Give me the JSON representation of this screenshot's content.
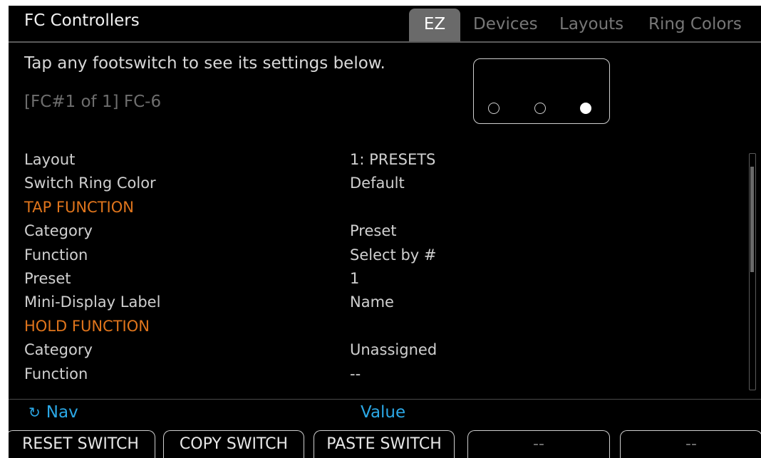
{
  "app": {
    "title": "FC Controllers"
  },
  "tabs": [
    {
      "label": "EZ",
      "active": true
    },
    {
      "label": "Devices",
      "active": false
    },
    {
      "label": "Layouts",
      "active": false
    },
    {
      "label": "Ring Colors",
      "active": false
    }
  ],
  "instruction": "Tap any footswitch to see its settings below.",
  "controller": {
    "name": "[FC#1 of 1] FC-6",
    "footswitches": [
      {
        "selected": false
      },
      {
        "selected": false
      },
      {
        "selected": true
      }
    ]
  },
  "settings": [
    {
      "label": "Layout",
      "value": "1: PRESETS"
    },
    {
      "label": "Switch Ring Color",
      "value": "Default"
    },
    {
      "label": "TAP FUNCTION",
      "value": "",
      "section": true
    },
    {
      "label": "Category",
      "value": "Preset"
    },
    {
      "label": "Function",
      "value": "Select by #"
    },
    {
      "label": "Preset",
      "value": "1"
    },
    {
      "label": "Mini-Display Label",
      "value": "Name"
    },
    {
      "label": "HOLD FUNCTION",
      "value": "",
      "section": true
    },
    {
      "label": "Category",
      "value": "Unassigned"
    },
    {
      "label": "Function",
      "value": "--"
    }
  ],
  "footer": {
    "nav_label": "Nav",
    "nav_icon": "rotate-knob-icon",
    "value_label": "Value",
    "accent_color": "#2ba8e6",
    "section_color": "#e0751c"
  },
  "softkeys": [
    {
      "label": "RESET SWITCH"
    },
    {
      "label": "COPY SWITCH"
    },
    {
      "label": "PASTE SWITCH"
    },
    {
      "label": "--"
    },
    {
      "label": "--"
    }
  ]
}
